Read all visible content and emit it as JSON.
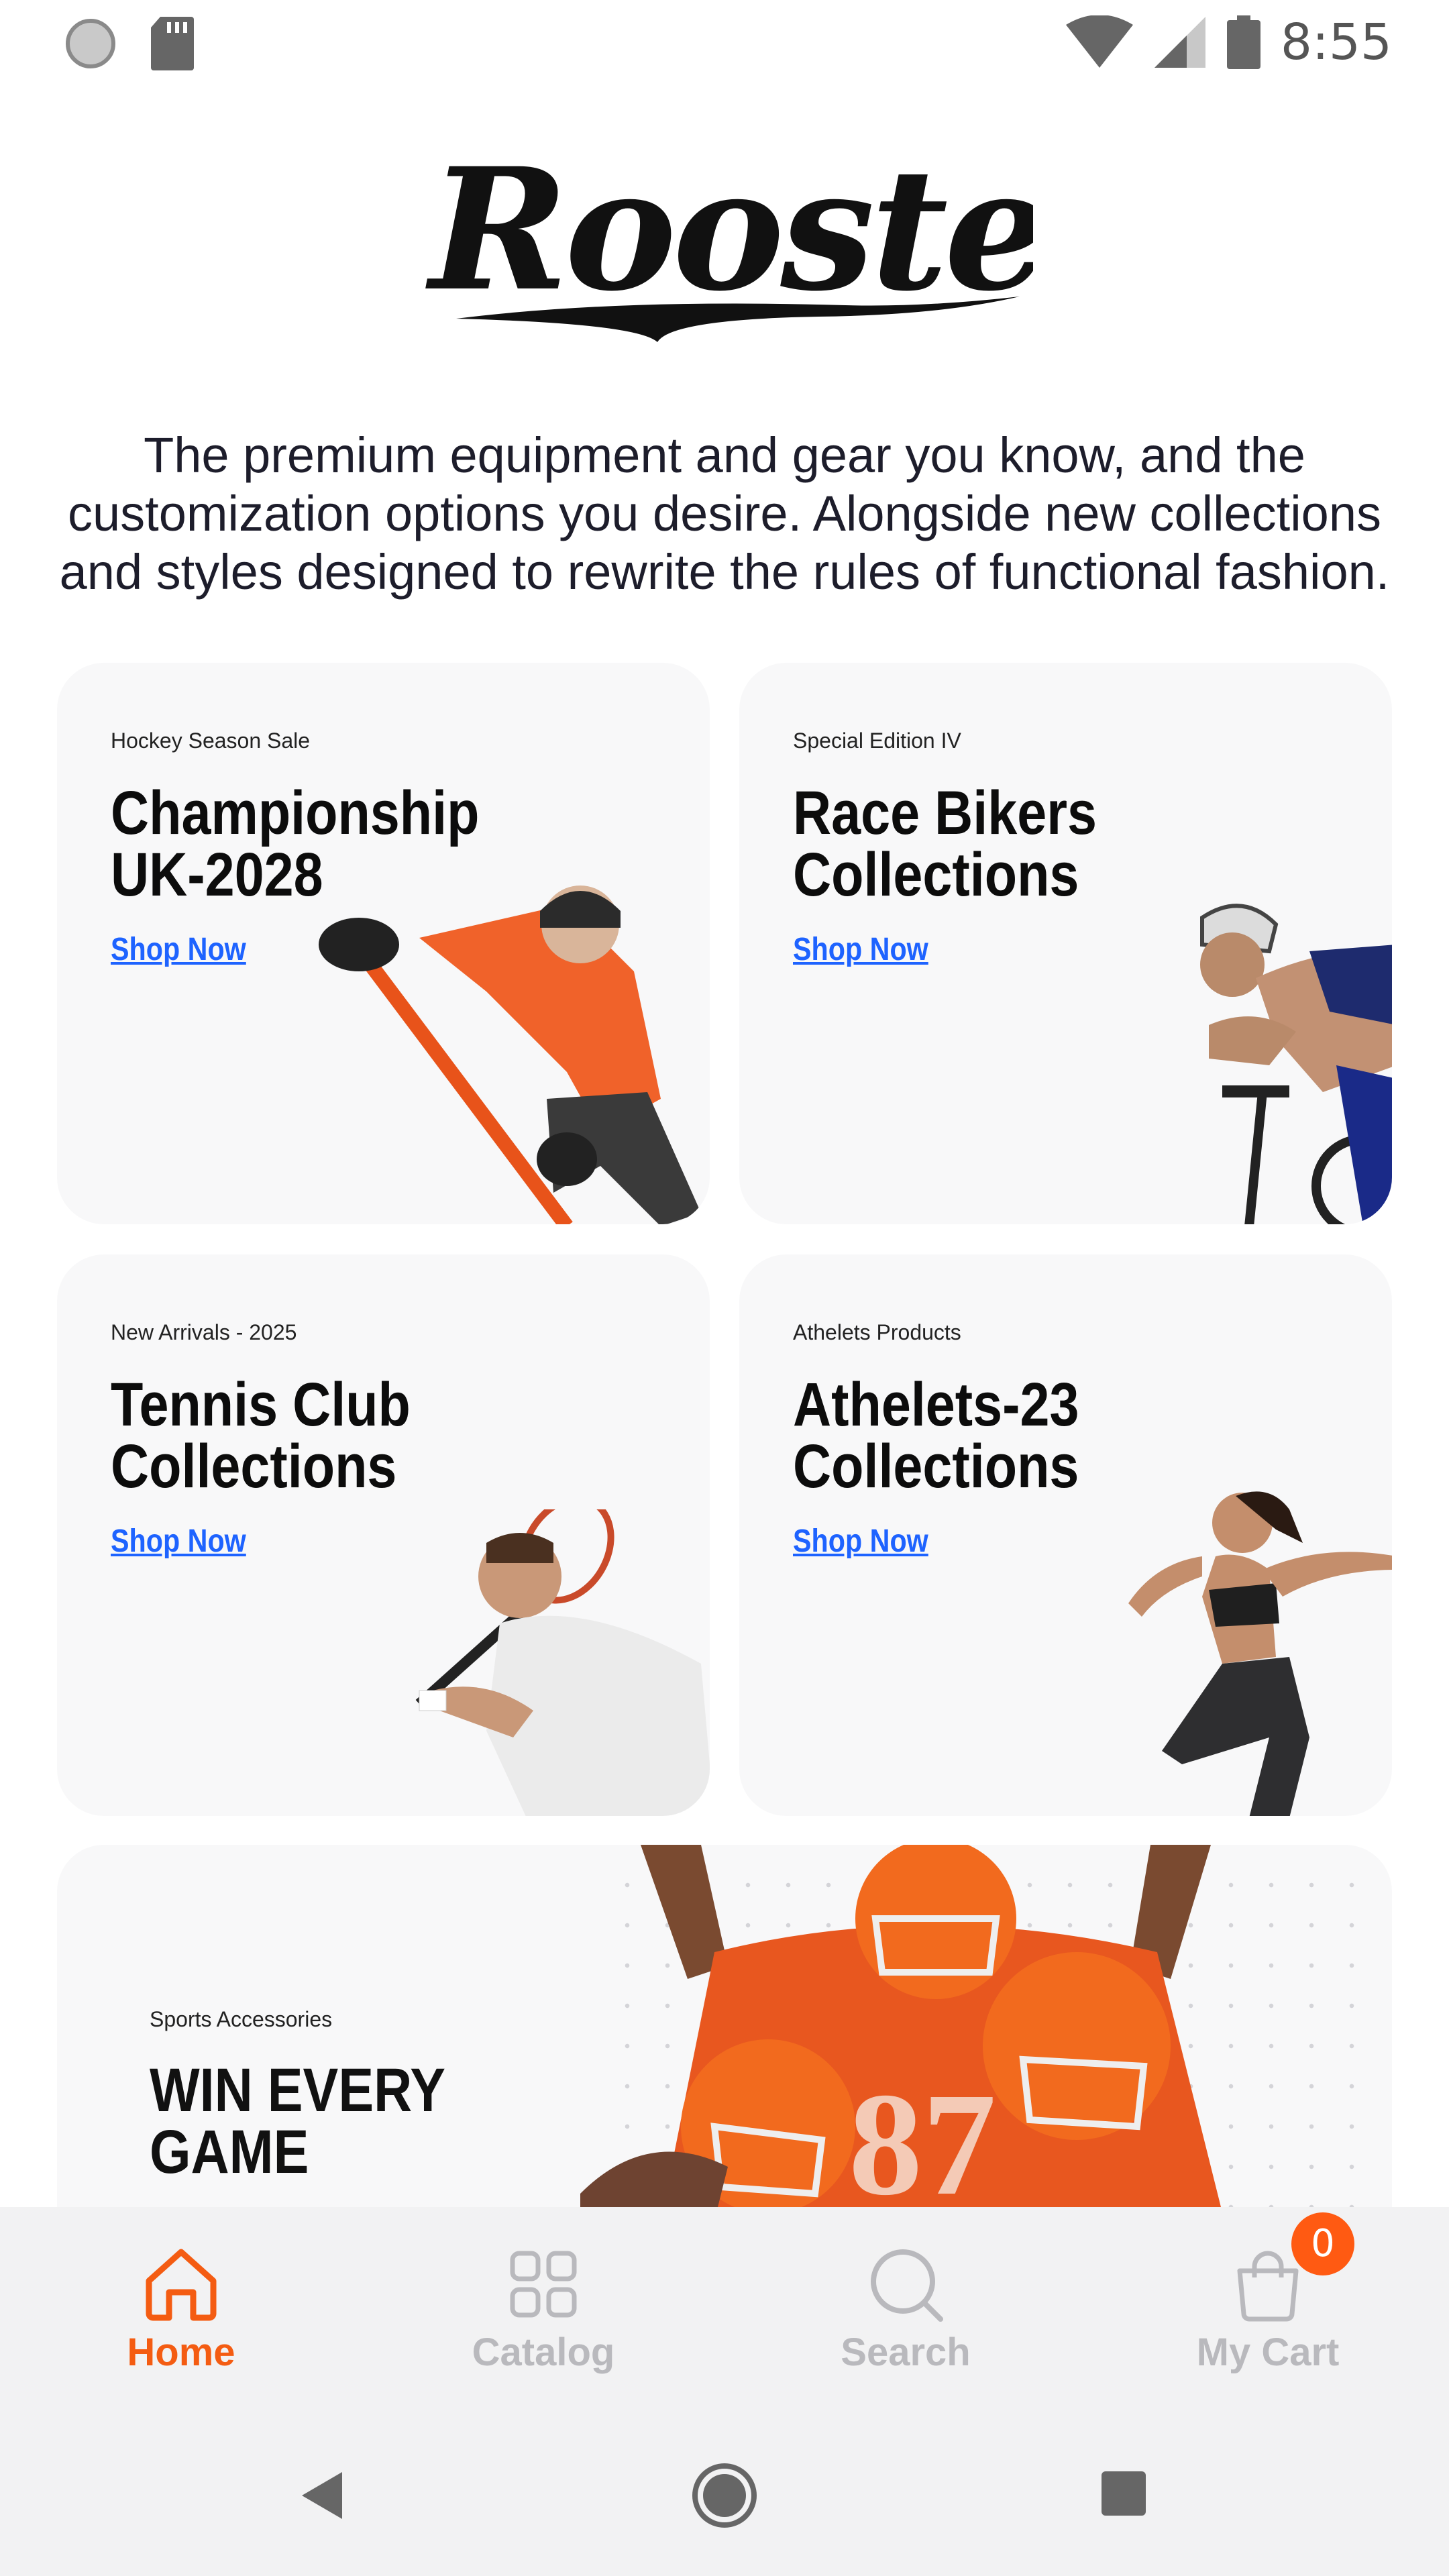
{
  "status_bar": {
    "time": "8:55"
  },
  "logo_text": "Rooster",
  "tagline": "The premium equipment and gear you know, and the customization options you desire. Alongside new collections and styles designed to rewrite the rules of functional fashion.",
  "cards": [
    {
      "eyebrow": "Hockey Season Sale",
      "title": "Championship UK-2028",
      "link": "Shop Now",
      "image": "hockey-player"
    },
    {
      "eyebrow": "Special Edition IV",
      "title": "Race Bikers Collections",
      "link": "Shop Now",
      "image": "cyclist"
    },
    {
      "eyebrow": "New Arrivals - 2025",
      "title": "Tennis Club Collections",
      "link": "Shop Now",
      "image": "tennis-player"
    },
    {
      "eyebrow": "Athelets Products",
      "title": "Athelets-23 Collections",
      "link": "Shop Now",
      "image": "runner"
    }
  ],
  "banner": {
    "eyebrow": "Sports Accessories",
    "title": "WIN EVERY GAME",
    "image": "football-players"
  },
  "bottom_nav": {
    "items": [
      {
        "label": "Home",
        "icon": "home-icon",
        "active": true
      },
      {
        "label": "Catalog",
        "icon": "grid-icon",
        "active": false
      },
      {
        "label": "Search",
        "icon": "search-icon",
        "active": false
      },
      {
        "label": "My Cart",
        "icon": "bag-icon",
        "active": false
      }
    ],
    "cart_count": "0"
  },
  "colors": {
    "accent": "#f45c12",
    "link": "#1e63ff",
    "card_bg": "#f8f8f9",
    "nav_bg": "#f2f2f3"
  }
}
